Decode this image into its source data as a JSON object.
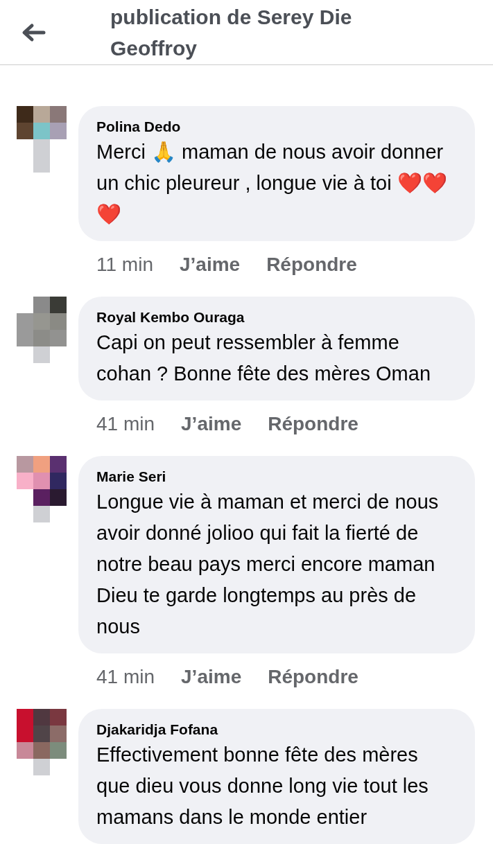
{
  "header": {
    "title": "publication de Serey Die Geoffroy"
  },
  "comments": [
    {
      "author": "Polina Dedo",
      "text": "Merci 🙏 maman de nous avoir donner un chic pleureur , longue vie à toi ❤️❤️❤️",
      "time": "11 min",
      "like": "J’aime",
      "reply": "Répondre"
    },
    {
      "author": "Royal Kembo Ouraga",
      "text": "Capi on peut ressembler à femme cohan ?  Bonne fête des mères Oman",
      "time": "41 min",
      "like": "J’aime",
      "reply": "Répondre"
    },
    {
      "author": "Marie Seri",
      "text": "Longue vie à maman et merci de nous avoir donné jolioo qui fait la fierté de notre beau pays merci encore maman Dieu te garde longtemps au près de nous",
      "time": "41 min",
      "like": "J’aime",
      "reply": "Répondre"
    },
    {
      "author": "Djakaridja Fofana",
      "text": "Effectivement bonne fête des mères que dieu vous donne long vie tout les mamans dans le monde entier"
    }
  ]
}
